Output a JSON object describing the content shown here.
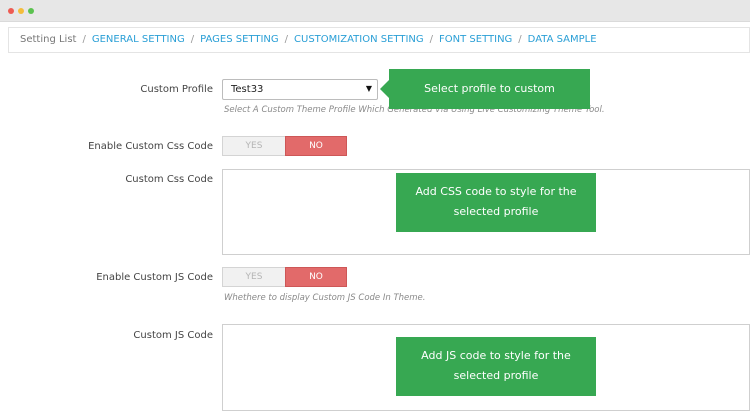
{
  "window": {
    "dots": [
      "red",
      "yellow",
      "green"
    ]
  },
  "breadcrumb": {
    "root": "Setting List",
    "separator": "/",
    "items": [
      "GENERAL SETTING",
      "PAGES SETTING",
      "CUSTOMIZATION SETTING",
      "FONT SETTING",
      "DATA SAMPLE"
    ]
  },
  "form": {
    "custom_profile": {
      "label": "Custom Profile",
      "value": "Test33",
      "help": "Select A Custom Theme Profile Which Generated Via Using Live Customizing Theme Tool."
    },
    "enable_css": {
      "label": "Enable Custom Css Code",
      "yes": "YES",
      "no": "NO",
      "selected": "NO"
    },
    "custom_css": {
      "label": "Custom Css Code",
      "value": ""
    },
    "enable_js": {
      "label": "Enable Custom JS Code",
      "yes": "YES",
      "no": "NO",
      "selected": "NO",
      "help": "Whethere to display Custom JS Code In Theme."
    },
    "custom_js": {
      "label": "Custom JS Code",
      "value": ""
    }
  },
  "callouts": {
    "profile": "Select profile to custom",
    "css_line1": "Add CSS code to style for the",
    "css_line2": "selected profile",
    "js_line1": "Add JS code to style for the",
    "js_line2": "selected profile"
  },
  "colors": {
    "link": "#2a9fd6",
    "callout": "#37a852",
    "toggle_no": "#e26a6a"
  }
}
